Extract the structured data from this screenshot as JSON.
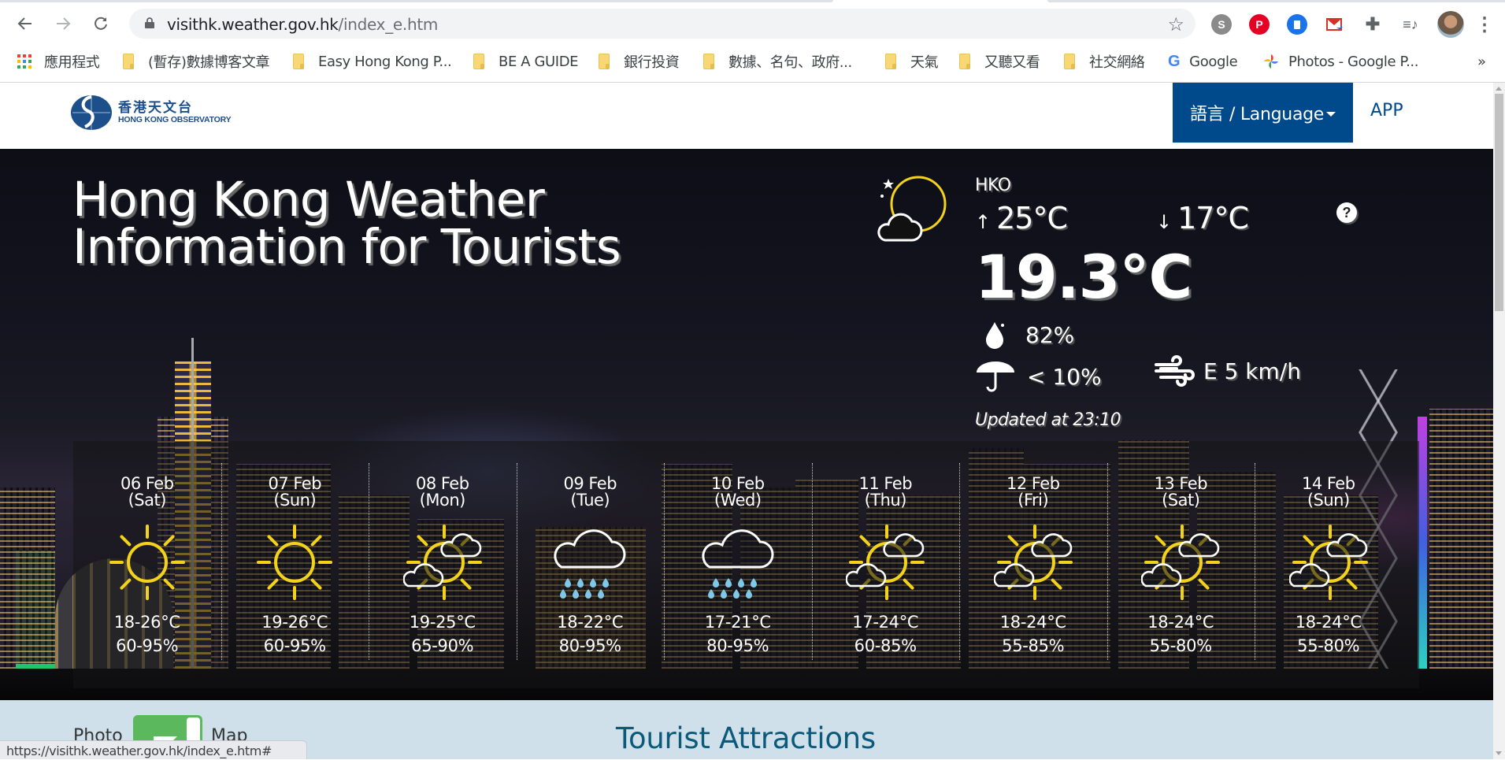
{
  "browser": {
    "url_host": "visithk.weather.gov.hk",
    "url_path": "/index_e.htm",
    "nav": {
      "back": "back-icon",
      "forward": "forward-icon",
      "reload": "reload-icon"
    },
    "extensions": [
      {
        "name": "skype-extension",
        "glyph": "S",
        "color": "#8a8a8a"
      },
      {
        "name": "pinterest-extension",
        "glyph": "P",
        "color": "#e60023"
      },
      {
        "name": "bookmark-extension",
        "glyph": "▮",
        "color": "#1a73e8"
      },
      {
        "name": "gmail-extension",
        "glyph": "M",
        "color": "#d93025"
      },
      {
        "name": "extensions-puzzle",
        "glyph": "✚",
        "color": "#5f6368"
      },
      {
        "name": "media-control",
        "glyph": "≡♪",
        "color": "#5f6368"
      }
    ],
    "bookmarks": [
      {
        "label": "應用程式",
        "type": "apps"
      },
      {
        "label": "(暫存)數據博客文章",
        "type": "folder"
      },
      {
        "label": "Easy Hong Kong P...",
        "type": "folder"
      },
      {
        "label": "BE A GUIDE",
        "type": "folder"
      },
      {
        "label": "銀行投資",
        "type": "folder"
      },
      {
        "label": "數據、名句、政府...",
        "type": "folder"
      },
      {
        "label": "天氣",
        "type": "folder"
      },
      {
        "label": "又聽又看",
        "type": "folder"
      },
      {
        "label": "社交網絡",
        "type": "folder"
      },
      {
        "label": "Google",
        "type": "google"
      },
      {
        "label": "Photos - Google P...",
        "type": "photos"
      }
    ],
    "bookmarks_overflow": "»",
    "status_url": "https://visithk.weather.gov.hk/index_e.htm#"
  },
  "header": {
    "logo_zh": "香港天文台",
    "logo_en": "HONG KONG OBSERVATORY",
    "language_label": "語言 / Language",
    "app_label": "APP",
    "brand_color": "#004a8c"
  },
  "hero": {
    "title_line1": "Hong Kong Weather",
    "title_line2": "Information for Tourists",
    "current": {
      "icon": "night-partly-cloudy-icon",
      "station": "HKO",
      "max_temp": "25°C",
      "min_temp": "17°C",
      "temperature": "19.3°C",
      "humidity": "82%",
      "rain_probability": "< 10%",
      "wind": "E 5 km/h",
      "updated": "Updated at 23:10"
    }
  },
  "forecast": [
    {
      "date": "06 Feb",
      "weekday": "(Sat)",
      "icon": "sunny",
      "temp": "18-26°C",
      "rh": "60-95%"
    },
    {
      "date": "07 Feb",
      "weekday": "(Sun)",
      "icon": "sunny",
      "temp": "19-26°C",
      "rh": "60-95%"
    },
    {
      "date": "08 Feb",
      "weekday": "(Mon)",
      "icon": "sunny-periods",
      "temp": "19-25°C",
      "rh": "65-90%"
    },
    {
      "date": "09 Feb",
      "weekday": "(Tue)",
      "icon": "rain",
      "temp": "18-22°C",
      "rh": "80-95%"
    },
    {
      "date": "10 Feb",
      "weekday": "(Wed)",
      "icon": "rain",
      "temp": "17-21°C",
      "rh": "80-95%"
    },
    {
      "date": "11 Feb",
      "weekday": "(Thu)",
      "icon": "sunny-periods",
      "temp": "17-24°C",
      "rh": "60-85%"
    },
    {
      "date": "12 Feb",
      "weekday": "(Fri)",
      "icon": "sunny-periods",
      "temp": "18-24°C",
      "rh": "55-85%"
    },
    {
      "date": "13 Feb",
      "weekday": "(Sat)",
      "icon": "sunny-periods",
      "temp": "18-24°C",
      "rh": "55-80%"
    },
    {
      "date": "14 Feb",
      "weekday": "(Sun)",
      "icon": "sunny-periods",
      "temp": "18-24°C",
      "rh": "55-80%"
    }
  ],
  "lower": {
    "toggle_left": "Photo",
    "toggle_right": "Map",
    "section_title": "Tourist Attractions"
  },
  "colors": {
    "sun": "#f2d21b",
    "rain_drop": "#7fc8e8",
    "lower_bg": "#cfe0ea",
    "title": "#0c5a7a"
  }
}
